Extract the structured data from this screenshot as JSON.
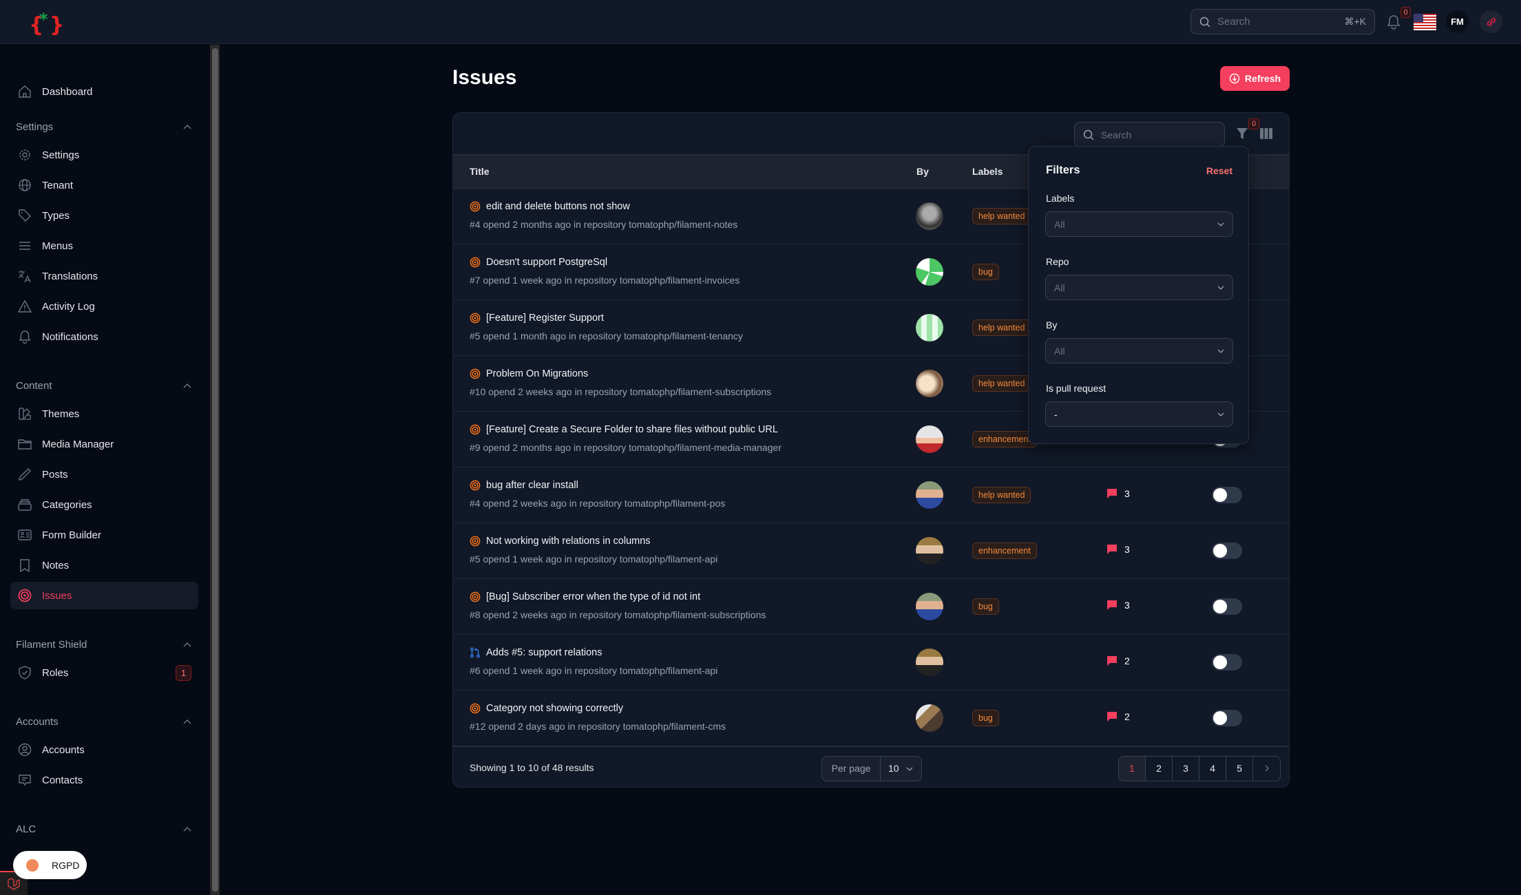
{
  "topbar": {
    "search_placeholder": "Search",
    "search_shortcut": "⌘+K",
    "notifications_count": "0",
    "user_initials": "FM"
  },
  "sidebar": {
    "dashboard": "Dashboard",
    "groups": [
      {
        "label": "Settings",
        "items": [
          "Settings",
          "Tenant",
          "Types",
          "Menus",
          "Translations",
          "Activity Log",
          "Notifications"
        ]
      },
      {
        "label": "Content",
        "items": [
          "Themes",
          "Media Manager",
          "Posts",
          "Categories",
          "Form Builder",
          "Notes",
          "Issues"
        ]
      },
      {
        "label": "Filament Shield",
        "items": [
          "Roles"
        ]
      },
      {
        "label": "Accounts",
        "items": [
          "Accounts",
          "Contacts"
        ]
      },
      {
        "label": "ALC",
        "items": []
      }
    ],
    "active_item": "Issues",
    "roles_badge": "1",
    "rgpd_label": "RGPD"
  },
  "page": {
    "title": "Issues",
    "refresh_label": "Refresh"
  },
  "table": {
    "search_placeholder": "Search",
    "filter_count": "0",
    "columns": {
      "title": "Title",
      "by": "By",
      "labels": "Labels"
    },
    "rows": [
      {
        "type": "issue",
        "title": "edit and delete buttons not show",
        "sub": "#4 opend 2 months ago in repository tomatophp/filament-notes",
        "label": "help wanted",
        "comments": "",
        "avatar": "bw"
      },
      {
        "type": "issue",
        "title": "Doesn't support PostgreSql",
        "sub": "#7 opend 1 week ago in repository tomatophp/filament-invoices",
        "label": "bug",
        "comments": "",
        "avatar": "green1"
      },
      {
        "type": "issue",
        "title": "[Feature] Register Support",
        "sub": "#5 opend 1 month ago in repository tomatophp/filament-tenancy",
        "label": "help wanted",
        "comments": "",
        "avatar": "green2"
      },
      {
        "type": "issue",
        "title": "Problem On Migrations",
        "sub": "#10 opend 2 weeks ago in repository tomatophp/filament-subscriptions",
        "label": "help wanted",
        "comments": "",
        "avatar": "anime"
      },
      {
        "type": "issue",
        "title": "[Feature] Create a Secure Folder to share files without public URL",
        "sub": "#9 opend 2 months ago in repository tomatophp/filament-media-manager",
        "label": "enhancement",
        "comments": "",
        "avatar": "red"
      },
      {
        "type": "issue",
        "title": "bug after clear install",
        "sub": "#4 opend 2 weeks ago in repository tomatophp/filament-pos",
        "label": "help wanted",
        "comments": "3",
        "avatar": "blue"
      },
      {
        "type": "issue",
        "title": "Not working with relations in columns",
        "sub": "#5 opend 1 week ago in repository tomatophp/filament-api",
        "label": "enhancement",
        "comments": "3",
        "avatar": "dark"
      },
      {
        "type": "issue",
        "title": "[Bug] Subscriber error when the type of id not int",
        "sub": "#8 opend 2 weeks ago in repository tomatophp/filament-subscriptions",
        "label": "bug",
        "comments": "3",
        "avatar": "blue"
      },
      {
        "type": "pull",
        "title": "Adds #5: support relations",
        "sub": "#6 opend 1 week ago in repository tomatophp/filament-api",
        "label": "",
        "comments": "2",
        "avatar": "dark"
      },
      {
        "type": "issue",
        "title": "Category not showing correctly",
        "sub": "#12 opend 2 days ago in repository tomatophp/filament-cms",
        "label": "bug",
        "comments": "2",
        "avatar": "hammer"
      }
    ],
    "showing": "Showing 1 to 10 of 48 results",
    "per_page_label": "Per page",
    "per_page_value": "10",
    "pages": [
      "1",
      "2",
      "3",
      "4",
      "5"
    ],
    "current_page": "1"
  },
  "filters": {
    "title": "Filters",
    "reset_label": "Reset",
    "fields": [
      {
        "label": "Labels",
        "value": "All",
        "is_placeholder": true
      },
      {
        "label": "Repo",
        "value": "All",
        "is_placeholder": true
      },
      {
        "label": "By",
        "value": "All",
        "is_placeholder": true
      },
      {
        "label": "Is pull request",
        "value": "-",
        "is_placeholder": false
      }
    ]
  },
  "colors": {
    "accent": "#f43f5e",
    "label_text": "#f58a3c",
    "issue_icon": "#f97316",
    "pull_icon": "#3b82f6"
  }
}
